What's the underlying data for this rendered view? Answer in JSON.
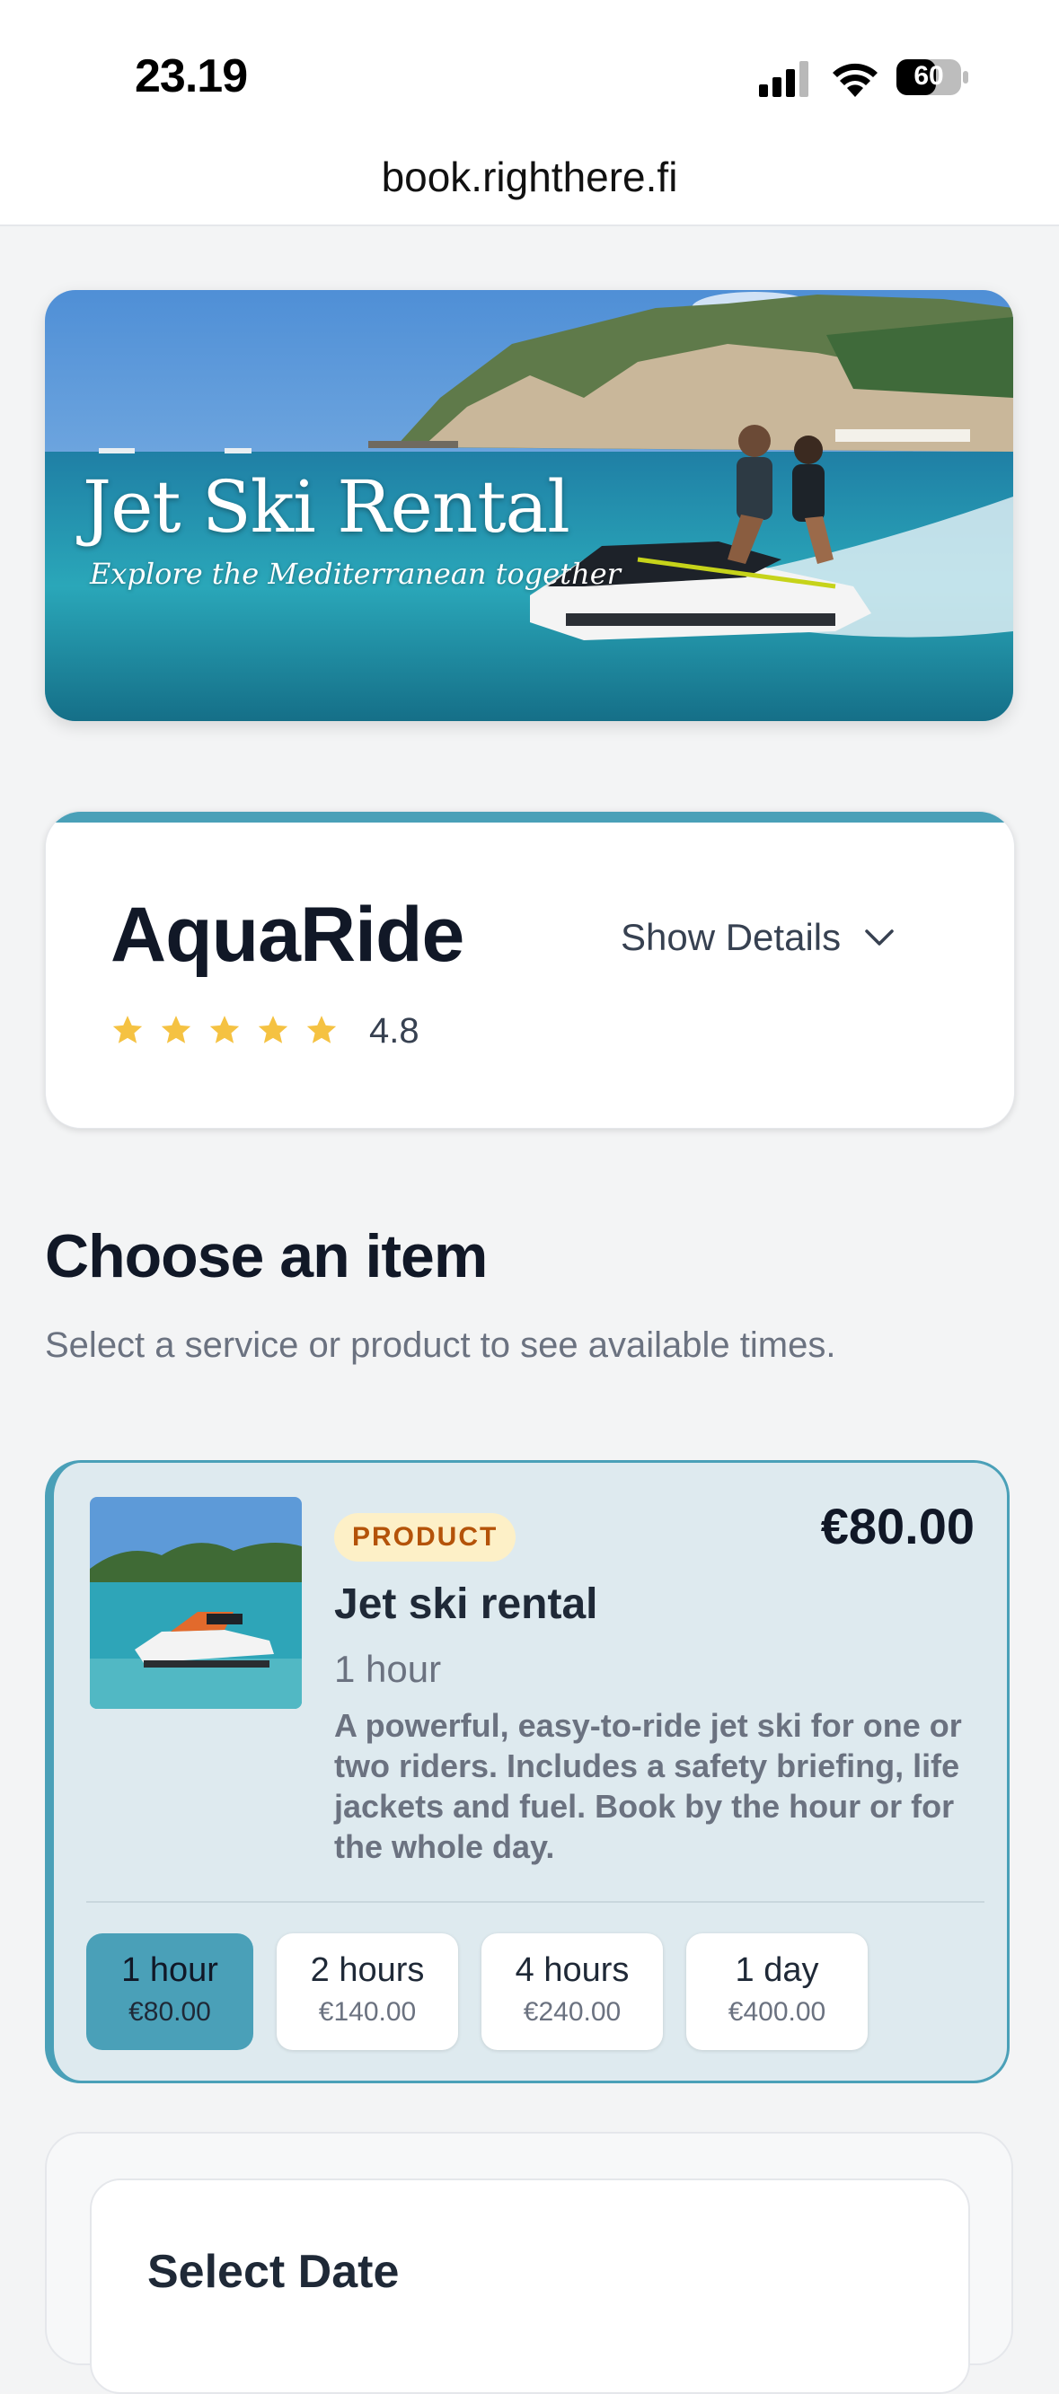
{
  "status": {
    "time": "23.19",
    "battery": "60"
  },
  "browser": {
    "url": "book.righthere.fi"
  },
  "hero": {
    "title": "Jet Ski Rental",
    "subtitle": "Explore the Mediterranean together"
  },
  "provider": {
    "name": "AquaRide",
    "rating": "4.8",
    "stars": 5,
    "details_label": "Show Details"
  },
  "section": {
    "title": "Choose an item",
    "subtitle": "Select a service or product to see available times."
  },
  "item": {
    "badge": "PRODUCT",
    "price": "€80.00",
    "title": "Jet ski rental",
    "duration": "1 hour",
    "description": "A powerful, easy-to-ride jet ski for one or two riders. Includes a safety briefing, life jackets and fuel. Book by the hour or for the whole day.",
    "options": [
      {
        "label": "1 hour",
        "price": "€80.00",
        "selected": true
      },
      {
        "label": "2 hours",
        "price": "€140.00",
        "selected": false
      },
      {
        "label": "4 hours",
        "price": "€240.00",
        "selected": false
      },
      {
        "label": "1 day",
        "price": "€400.00",
        "selected": false
      }
    ]
  },
  "date_section": {
    "title": "Select Date"
  },
  "colors": {
    "accent": "#4aa0b8",
    "star": "#f5c242",
    "badge_bg": "#fdf0c7",
    "badge_text": "#b45309"
  }
}
